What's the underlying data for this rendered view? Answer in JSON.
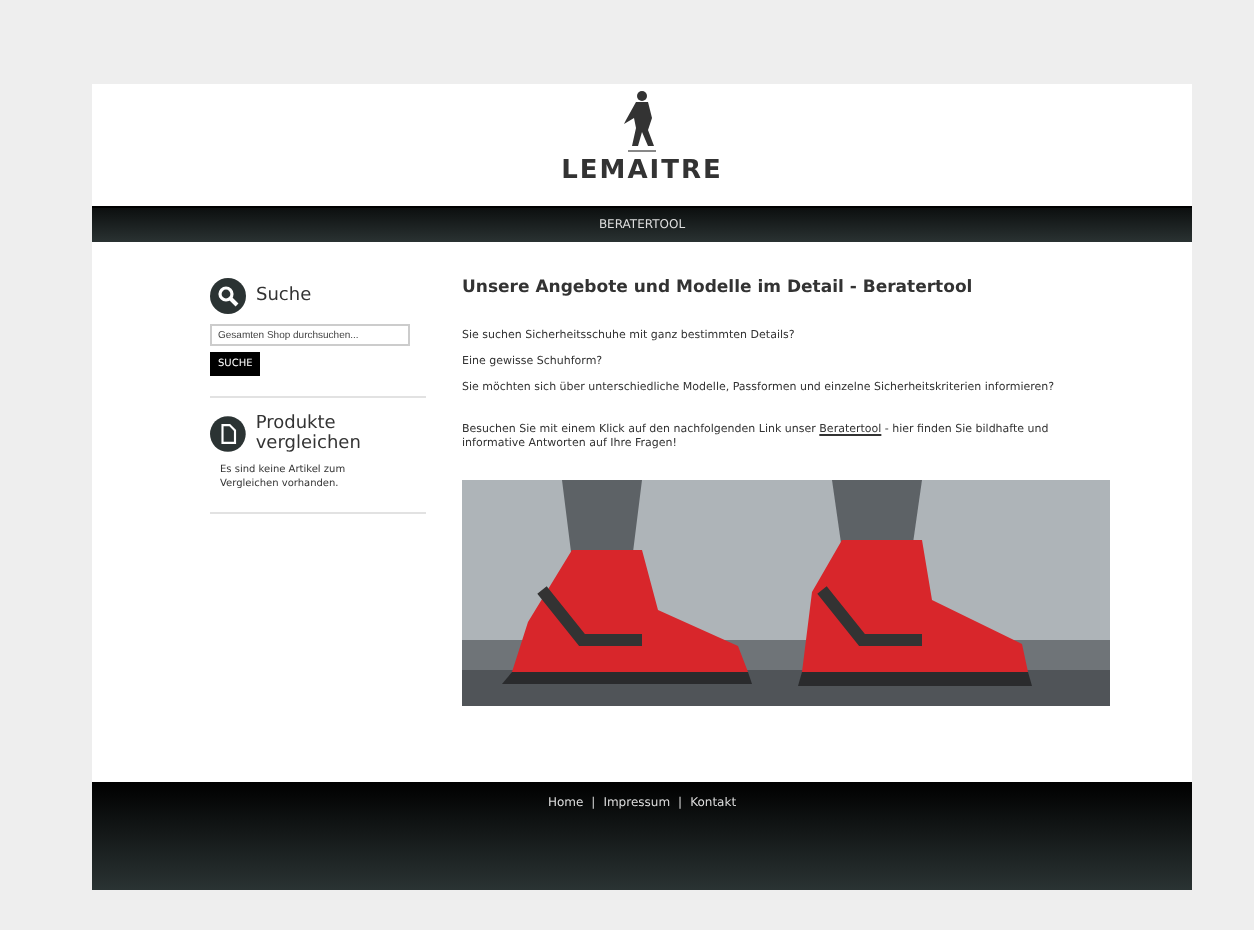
{
  "header": {
    "logo": "LEMAITRE"
  },
  "nav": {
    "items": [
      "BERATERTOOL"
    ]
  },
  "sidebar": {
    "search": {
      "title": "Suche",
      "placeholder": "Gesamten Shop durchsuchen...",
      "button": "SUCHE"
    },
    "compare": {
      "title": "Produkte vergleichen",
      "text": "Es sind keine Artikel zum Vergleichen vorhanden."
    }
  },
  "main": {
    "heading": "Unsere Angebote und Modelle im Detail - Beratertool",
    "questions": [
      "Sie suchen Sicherheitsschuhe mit ganz bestimmten Details?",
      "Eine gewisse Schuhform?",
      "Sie möchten sich über unterschiedliche Modelle, Passformen und einzelne Sicherheitskriterien informieren?"
    ],
    "invite": {
      "before": "Besuchen Sie mit einem Klick auf den nachfolgenden Link unser",
      "link": "Beratertool",
      "after": "- hier finden Sie bildhafte und informative Antworten auf Ihre Fragen!"
    }
  },
  "footer": {
    "links": [
      "Home",
      "Impressum",
      "Kontakt"
    ],
    "separator": "|"
  }
}
